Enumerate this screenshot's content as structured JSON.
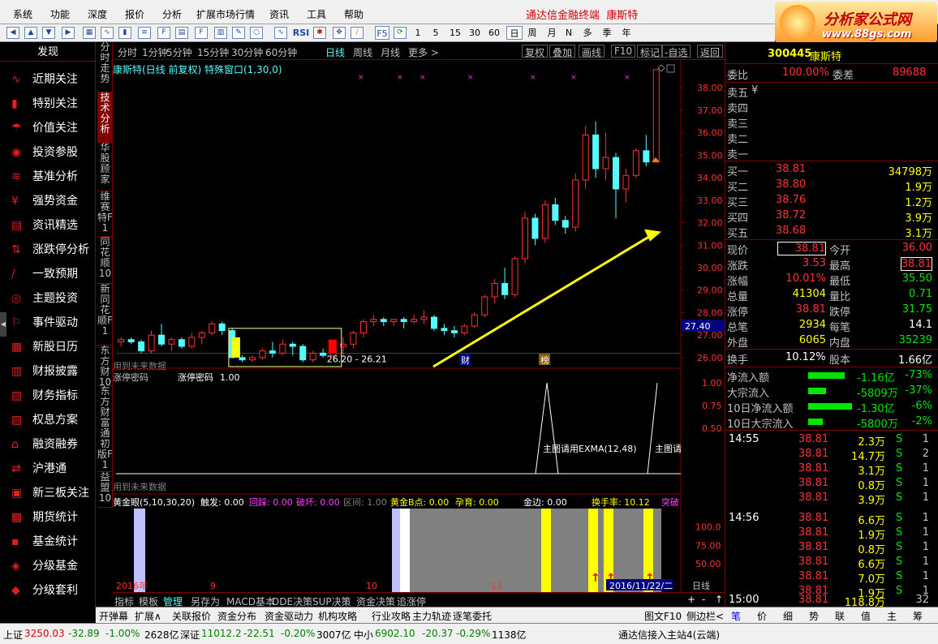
{
  "menu": [
    "系统",
    "功能",
    "深度",
    "报价",
    "分析",
    "扩展市场行情",
    "资讯",
    "工具",
    "帮助"
  ],
  "app_title": "通达信金融终端",
  "stock_name_title": "康斯特",
  "logo": {
    "line1": "分析家公式网",
    "line2": "www.88gs.com"
  },
  "toolbar": {
    "rsi": "RSI",
    "f5": "F5",
    "periods": [
      "1",
      "5",
      "15",
      "30",
      "60"
    ],
    "cycles": [
      "日",
      "周",
      "月",
      "N",
      "多",
      "季",
      "年"
    ]
  },
  "sidebar": {
    "header": "发现",
    "items": [
      {
        "label": "近期关注",
        "icon": "chart-line-icon"
      },
      {
        "label": "特别关注",
        "icon": "bar-icon"
      },
      {
        "label": "价值关注",
        "icon": "umbrella-icon"
      },
      {
        "label": "投资参股",
        "icon": "people-icon"
      },
      {
        "label": "基准分析",
        "icon": "chart-icon"
      },
      {
        "label": "强势资金",
        "icon": "money-icon"
      },
      {
        "label": "资讯精选",
        "icon": "doc-icon"
      },
      {
        "label": "涨跌停分析",
        "icon": "updown-icon"
      },
      {
        "label": "一致预期",
        "icon": "line-icon"
      },
      {
        "label": "主题投资",
        "icon": "target-icon"
      },
      {
        "label": "事件驱动",
        "icon": "event-icon"
      },
      {
        "label": "新股日历",
        "icon": "calendar-icon"
      },
      {
        "label": "财报披露",
        "icon": "report-icon"
      },
      {
        "label": "财务指标",
        "icon": "finance-icon"
      },
      {
        "label": "权息方案",
        "icon": "plan-icon"
      },
      {
        "label": "融资融券",
        "icon": "bank-icon"
      },
      {
        "label": "沪港通",
        "icon": "hk-icon"
      },
      {
        "label": "新三板关注",
        "icon": "board-icon"
      },
      {
        "label": "期货统计",
        "icon": "futures-icon"
      },
      {
        "label": "基金统计",
        "icon": "fund-icon"
      },
      {
        "label": "分级基金",
        "icon": "grade-icon"
      },
      {
        "label": "分级套利",
        "icon": "arb-icon"
      }
    ]
  },
  "vtabs": [
    "分时走势",
    "技术分析",
    "华股顾家",
    "维赛特F1",
    "同花顺10",
    "新同花顺F1",
    "东方财10",
    "东方财富通初版F1",
    "益盟10"
  ],
  "periodbar": {
    "items": [
      "分时",
      "1分钟",
      "5分钟",
      "15分钟",
      "30分钟",
      "60分钟",
      "日线",
      "周线",
      "月线",
      "更多 >"
    ],
    "active": "日线",
    "tools": [
      "复权",
      "叠加",
      "画线",
      "F10",
      "标记",
      "-自选",
      "返回"
    ]
  },
  "main_chart": {
    "title": "康斯特(日线 前复权) 特殊窗口(1,30,0)",
    "future_note": "用到未来数据",
    "box_label": "26.20 - 26.21",
    "price_now": "27.40",
    "badge1": "财",
    "badge2": "榜",
    "yticks": [
      "38.00",
      "37.00",
      "36.00",
      "35.00",
      "34.00",
      "33.00",
      "32.00",
      "31.00",
      "30.00",
      "29.00",
      "28.00",
      "27.00",
      "26.00"
    ]
  },
  "chart_data": [
    {
      "type": "candlestick",
      "title": "康斯特(日线 前复权)",
      "ylim": [
        25.6,
        38.8
      ],
      "ohlc": [
        [
          26.7,
          26.9,
          26.5,
          26.8
        ],
        [
          26.8,
          26.9,
          26.6,
          26.7
        ],
        [
          26.7,
          26.8,
          26.2,
          26.3
        ],
        [
          26.3,
          27.2,
          26.2,
          27.0
        ],
        [
          27.0,
          27.5,
          26.5,
          26.6
        ],
        [
          26.6,
          26.9,
          26.3,
          26.8
        ],
        [
          26.8,
          26.9,
          26.4,
          26.5
        ],
        [
          26.5,
          27.1,
          26.4,
          26.9
        ],
        [
          26.9,
          27.2,
          26.6,
          27.1
        ],
        [
          27.1,
          27.6,
          27.0,
          27.5
        ],
        [
          27.5,
          27.6,
          27.0,
          27.2
        ],
        [
          27.2,
          27.3,
          26.0,
          26.0
        ],
        [
          26.0,
          26.1,
          25.8,
          25.9
        ],
        [
          25.9,
          26.1,
          25.8,
          26.0
        ],
        [
          26.0,
          26.4,
          25.9,
          26.3
        ],
        [
          26.3,
          26.7,
          26.0,
          26.2
        ],
        [
          26.2,
          26.8,
          26.1,
          26.6
        ],
        [
          26.6,
          26.7,
          26.1,
          26.5
        ],
        [
          26.5,
          26.6,
          25.8,
          25.9
        ],
        [
          25.9,
          26.3,
          25.8,
          26.2
        ],
        [
          26.2,
          26.4,
          26.0,
          26.1
        ],
        [
          26.1,
          26.7,
          26.0,
          26.5
        ],
        [
          26.5,
          26.9,
          26.1,
          26.6
        ],
        [
          26.6,
          27.2,
          26.4,
          27.1
        ],
        [
          27.1,
          27.7,
          26.9,
          27.6
        ],
        [
          27.6,
          27.9,
          27.4,
          27.7
        ],
        [
          27.7,
          27.8,
          27.4,
          27.6
        ],
        [
          27.6,
          27.7,
          27.4,
          27.7
        ],
        [
          27.7,
          27.8,
          27.3,
          27.6
        ],
        [
          27.6,
          27.9,
          27.5,
          27.7
        ],
        [
          27.7,
          28.1,
          27.5,
          27.8
        ],
        [
          27.8,
          27.9,
          27.2,
          27.3
        ],
        [
          27.3,
          27.5,
          27.0,
          27.2
        ],
        [
          27.2,
          27.4,
          26.9,
          27.1
        ],
        [
          27.1,
          27.5,
          27.0,
          27.4
        ],
        [
          27.4,
          28.0,
          27.3,
          27.9
        ],
        [
          27.9,
          28.8,
          27.8,
          28.7
        ],
        [
          28.7,
          29.5,
          28.4,
          29.3
        ],
        [
          29.3,
          30.0,
          28.6,
          28.8
        ],
        [
          28.8,
          30.5,
          28.7,
          30.4
        ],
        [
          30.4,
          32.5,
          30.2,
          32.2
        ],
        [
          32.2,
          32.4,
          31.0,
          31.3
        ],
        [
          31.3,
          33.0,
          31.1,
          32.8
        ],
        [
          32.8,
          33.1,
          31.9,
          32.1
        ],
        [
          32.1,
          32.3,
          31.5,
          31.8
        ],
        [
          31.8,
          34.2,
          31.6,
          33.9
        ],
        [
          33.9,
          36.3,
          33.5,
          35.9
        ],
        [
          35.9,
          36.5,
          34.0,
          34.4
        ],
        [
          34.4,
          36.0,
          33.9,
          34.9
        ],
        [
          34.9,
          35.1,
          32.2,
          33.5
        ],
        [
          33.5,
          34.4,
          32.9,
          34.1
        ],
        [
          34.1,
          35.3,
          34.0,
          35.2
        ],
        [
          35.2,
          35.9,
          34.5,
          34.7
        ],
        [
          34.7,
          38.81,
          34.7,
          38.81
        ]
      ]
    },
    {
      "type": "line",
      "title": "涨停密码",
      "series": [
        {
          "name": "涨停密码",
          "value": "1.00"
        }
      ],
      "ylim": [
        0,
        1
      ],
      "yticks": [
        "1.00",
        "0.75",
        "0.50"
      ],
      "annotation": "主图请用EXMA(12,48)",
      "annotation2": "主图请",
      "future_note": "用到未来数据"
    },
    {
      "type": "bar",
      "title": "黄金眼(5,10,30,20)",
      "yticks": [
        "100.0",
        "75.00",
        "50.00"
      ],
      "labels": {
        "chufa": "触发: 0.00",
        "huicai": "回踩: 0.00",
        "pohuai": "破坏: 0.00",
        "qujian": "区间: 1.00",
        "huangjin": "黄金B点: 0.00",
        "yunyu": "孕育: 0.00",
        "jinbian": "金边: 0.00",
        "huanshou": "换手率: 10.12",
        "tupo": "突破"
      }
    },
    {
      "type": "table",
      "x_axis": [
        "2016年",
        "9",
        "10",
        "11",
        "2016/11/22/二"
      ],
      "period": "日线"
    }
  ],
  "quote": {
    "code": "300445",
    "name": "康斯特",
    "weibi_label": "委比",
    "weibi": "100.00%",
    "weicha_label": "委差",
    "weicha": "89688",
    "sells": [
      {
        "label": "卖五",
        "price": "¥",
        "vol": ""
      },
      {
        "label": "卖四",
        "price": "",
        "vol": ""
      },
      {
        "label": "卖三",
        "price": "",
        "vol": ""
      },
      {
        "label": "卖二",
        "price": "",
        "vol": ""
      },
      {
        "label": "卖一",
        "price": "",
        "vol": ""
      }
    ],
    "buys": [
      {
        "label": "买一",
        "price": "38.81",
        "vol": "34798万"
      },
      {
        "label": "买二",
        "price": "38.80",
        "vol": "1.9万"
      },
      {
        "label": "买三",
        "price": "38.76",
        "vol": "1.2万"
      },
      {
        "label": "买四",
        "price": "38.72",
        "vol": "3.9万"
      },
      {
        "label": "买五",
        "price": "38.68",
        "vol": "3.1万"
      }
    ],
    "stats": [
      {
        "l1": "现价",
        "v1": "38.81",
        "l2": "今开",
        "v2": "36.00"
      },
      {
        "l1": "涨跌",
        "v1": "3.53",
        "l2": "最高",
        "v2": "38.81"
      },
      {
        "l1": "涨幅",
        "v1": "10.01%",
        "l2": "最低",
        "v2": "35.50"
      },
      {
        "l1": "总量",
        "v1": "41304",
        "l2": "量比",
        "v2": "0.71"
      },
      {
        "l1": "涨停",
        "v1": "38.81",
        "l2": "跌停",
        "v2": "31.75"
      },
      {
        "l1": "总笔",
        "v1": "2934",
        "l2": "每笔",
        "v2": "14.1"
      },
      {
        "l1": "外盘",
        "v1": "6065",
        "l2": "内盘",
        "v2": "35239"
      }
    ],
    "turnover_label": "换手",
    "turnover": "10.12%",
    "equity_label": "股本",
    "equity": "1.66亿",
    "flows": [
      {
        "label": "净流入额",
        "val": "-1.16亿",
        "pct": "-73%",
        "bar": 0.75
      },
      {
        "label": "大宗流入",
        "val": "-5809万",
        "pct": "-37%",
        "bar": 0.37
      },
      {
        "label": "10日净流入额",
        "val": "-1.30亿",
        "pct": "-6%",
        "bar": 0.9
      },
      {
        "label": "10日大宗流入",
        "val": "-5800万",
        "pct": "-2%",
        "bar": 0.3
      }
    ],
    "ticks": [
      {
        "time": "14:55",
        "price": "38.81",
        "vol": "2.3万",
        "dir": "S",
        "n": "1"
      },
      {
        "time": "",
        "price": "38.81",
        "vol": "14.7万",
        "dir": "S",
        "n": "2"
      },
      {
        "time": "",
        "price": "38.81",
        "vol": "3.1万",
        "dir": "S",
        "n": "1"
      },
      {
        "time": "",
        "price": "38.81",
        "vol": "0.8万",
        "dir": "S",
        "n": "1"
      },
      {
        "time": "",
        "price": "38.81",
        "vol": "3.9万",
        "dir": "S",
        "n": "1"
      },
      {
        "time": "14:56",
        "price": "38.81",
        "vol": "6.6万",
        "dir": "S",
        "n": "1"
      },
      {
        "time": "",
        "price": "38.81",
        "vol": "1.9万",
        "dir": "S",
        "n": "1"
      },
      {
        "time": "",
        "price": "38.81",
        "vol": "0.8万",
        "dir": "S",
        "n": "1"
      },
      {
        "time": "",
        "price": "38.81",
        "vol": "6.6万",
        "dir": "S",
        "n": "1"
      },
      {
        "time": "",
        "price": "38.81",
        "vol": "7.0万",
        "dir": "S",
        "n": "1"
      },
      {
        "time": "",
        "price": "38.81",
        "vol": "1.9万",
        "dir": "S",
        "n": "1"
      },
      {
        "time": "15:00",
        "price": "38.81",
        "vol": "118.8万",
        "dir": "",
        "n": "32"
      }
    ],
    "tabs": [
      "笔",
      "价",
      "细",
      "势",
      "联",
      "值",
      "主",
      "筹"
    ]
  },
  "bottomtabs": [
    "开弹幕",
    "扩展∧",
    "关联报价",
    "资金分布",
    "资金驱动力",
    "机构攻略",
    "行业攻略",
    "主力轨迹",
    "逐笔委托"
  ],
  "bottomtabs_left": [
    "指标",
    "模板",
    "管理",
    "另存为",
    "MACD基本",
    "DDE决策",
    "SUP决策",
    "资金决策",
    "追涨停"
  ],
  "bottomtabs_active": "管理",
  "bottomright": [
    "图文F10",
    "侧边栏<"
  ],
  "status": {
    "sh_label": "上证",
    "sh_val": "3250.03",
    "sh_chg": "-32.89",
    "sh_pct": "-1.00%",
    "sh_amt": "2628亿",
    "sz_label": "深证",
    "sz_val": "11012.2",
    "sz_chg": "-22.51",
    "sz_pct": "-0.20%",
    "sz_amt": "3007亿",
    "zx_label": "中小",
    "zx_val": "6902.10",
    "zx_chg": "-20.37",
    "zx_pct": "-0.29%",
    "zx_amt": "1138亿",
    "server": "通达信接入主站4(云端)"
  },
  "colors": {
    "up": "#ff3232",
    "down": "#54fcfc",
    "bg": "#000000",
    "grid": "#800000",
    "accent": "#ffff00"
  }
}
